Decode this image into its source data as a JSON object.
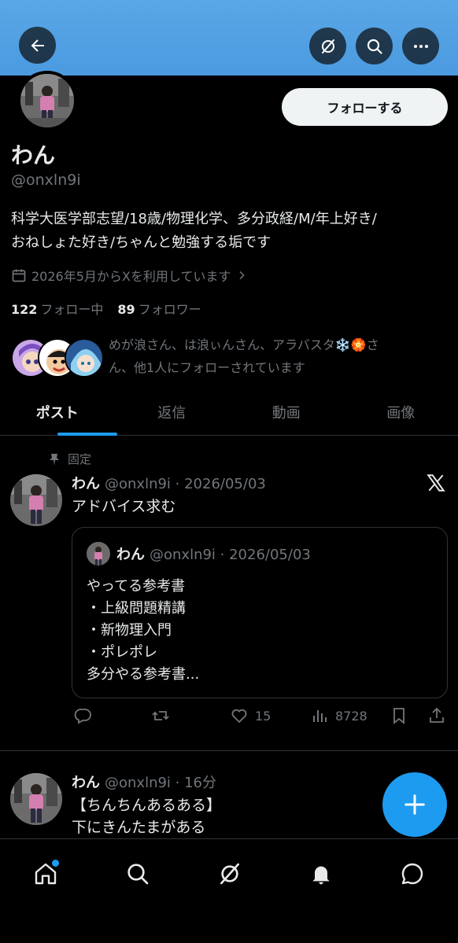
{
  "header": {
    "back_icon": "arrow-left-icon",
    "grok_icon": "grok-icon",
    "search_icon": "search-icon",
    "more_icon": "more-icon"
  },
  "profile": {
    "follow_label": "フォローする",
    "display_name": "わん",
    "handle": "@onxln9i",
    "bio_line1": "科学大医学部志望/18歳/物理化学、多分政経/M/年上好き/",
    "bio_line2": "おねしょた好き/ちゃんと勉強する垢です",
    "joined": "2026年5月からXを利用しています",
    "following_count": "122",
    "following_label": "フォロー中",
    "followers_count": "89",
    "followers_label": "フォロワー",
    "followed_by_line1": "めが浪さん、は浪ぃんさん、アラバスタ❄️🏵️さ",
    "followed_by_line2": "ん、他1人にフォローされています"
  },
  "tabs": [
    "ポスト",
    "返信",
    "動画",
    "画像"
  ],
  "posts": [
    {
      "pinned_label": "固定",
      "name": "わん",
      "meta": "@onxln9i · 2026/05/03",
      "text": "アドバイス求む",
      "quote": {
        "name": "わん",
        "meta": "@onxln9i · 2026/05/03",
        "lines": [
          "やってる参考書",
          "・上級問題精講",
          "・新物理入門",
          "・ポレポレ",
          "多分やる参考書..."
        ]
      },
      "likes": "15",
      "views": "8728"
    },
    {
      "name": "わん",
      "meta": "@onxln9i · 16分",
      "line1": "【ちんちんあるある】",
      "line2": "下にきんたまがある"
    }
  ],
  "colors": {
    "accent": "#1d9bf0",
    "banner": "#4b9ae0",
    "background": "#000000",
    "muted_text": "#71767b"
  }
}
